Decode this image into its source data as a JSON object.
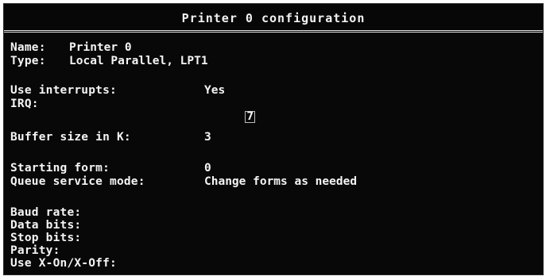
{
  "window": {
    "title": "Printer 0 configuration"
  },
  "printer": {
    "name_label": "Name:",
    "name_value": "Printer 0",
    "type_label": "Type:",
    "type_value": "Local Parallel, LPT1"
  },
  "interrupts": {
    "use_label": "Use interrupts:",
    "use_value": "Yes",
    "irq_label": "IRQ:",
    "irq_value": "7"
  },
  "buffer": {
    "label": "Buffer size in K:",
    "value": "3"
  },
  "forms": {
    "starting_label": "Starting form:",
    "starting_value": "0",
    "queue_label": "Queue service mode:",
    "queue_value": "Change forms as needed"
  },
  "serial": {
    "baud_label": "Baud rate:",
    "data_bits_label": "Data bits:",
    "stop_bits_label": "Stop bits:",
    "parity_label": "Parity:",
    "xon_label": "Use X-On/X-Off:"
  }
}
